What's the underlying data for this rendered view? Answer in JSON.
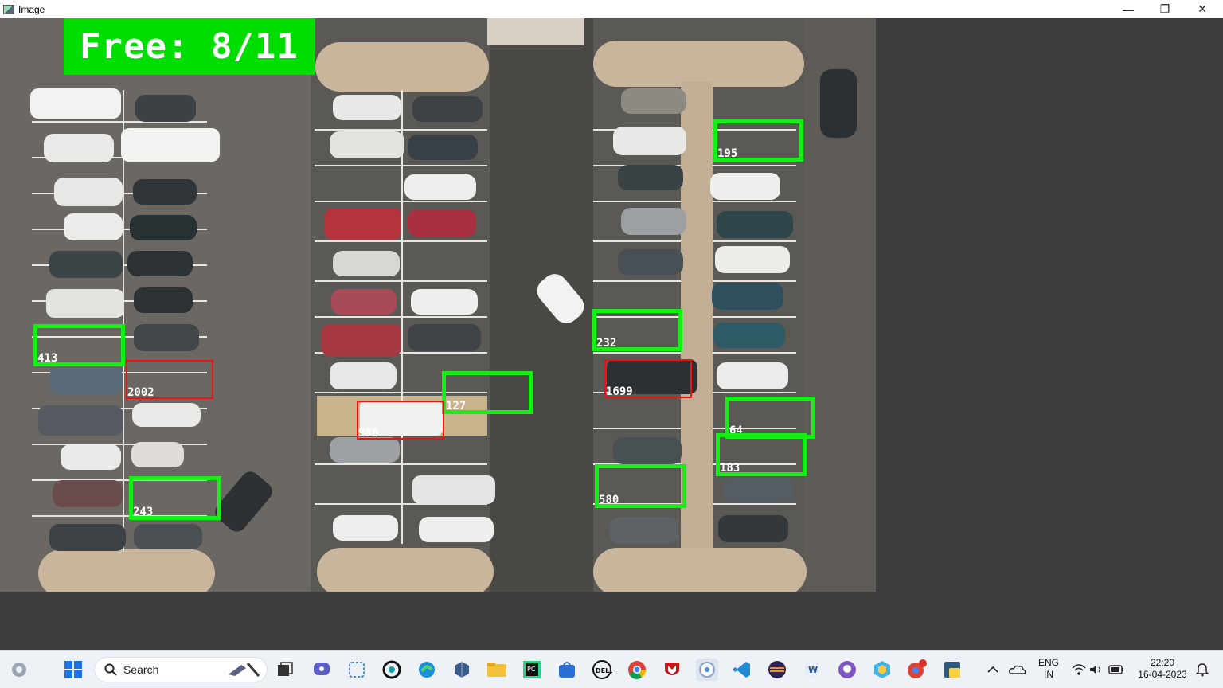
{
  "window": {
    "title": "Image",
    "minimize_label": "—",
    "restore_label": "❐",
    "close_label": "✕"
  },
  "overlay": {
    "free_text": "Free: 8/11"
  },
  "spots": [
    {
      "id": "195",
      "status": "free"
    },
    {
      "id": "413",
      "status": "free"
    },
    {
      "id": "232",
      "status": "free"
    },
    {
      "id": "2002",
      "status": "occupied"
    },
    {
      "id": "1699",
      "status": "occupied"
    },
    {
      "id": "127",
      "status": "free"
    },
    {
      "id": "986",
      "status": "occupied"
    },
    {
      "id": "64",
      "status": "free"
    },
    {
      "id": "183",
      "status": "free"
    },
    {
      "id": "243",
      "status": "free"
    },
    {
      "id": "580",
      "status": "free"
    }
  ],
  "colors": {
    "free": "#14f014",
    "occupied": "#f01010",
    "overlay_bg": "#00dd00"
  },
  "taskbar": {
    "search_placeholder": "Search",
    "apps": [
      "widgets-icon",
      "start-icon",
      "task-view-icon",
      "chat-icon",
      "snipping-icon",
      "copilot-icon",
      "edge-icon",
      "3d-icon",
      "file-explorer-icon",
      "pycharm-icon",
      "store-icon",
      "dell-icon",
      "chrome-icon",
      "mcafee-icon",
      "camera-icon",
      "vscode-icon",
      "eclipse-icon",
      "word-icon",
      "github-icon",
      "hexagon-icon",
      "chrome-profile-icon",
      "python-icon"
    ],
    "language": "ENG",
    "region": "IN",
    "time": "22:20",
    "date": "16-04-2023"
  }
}
